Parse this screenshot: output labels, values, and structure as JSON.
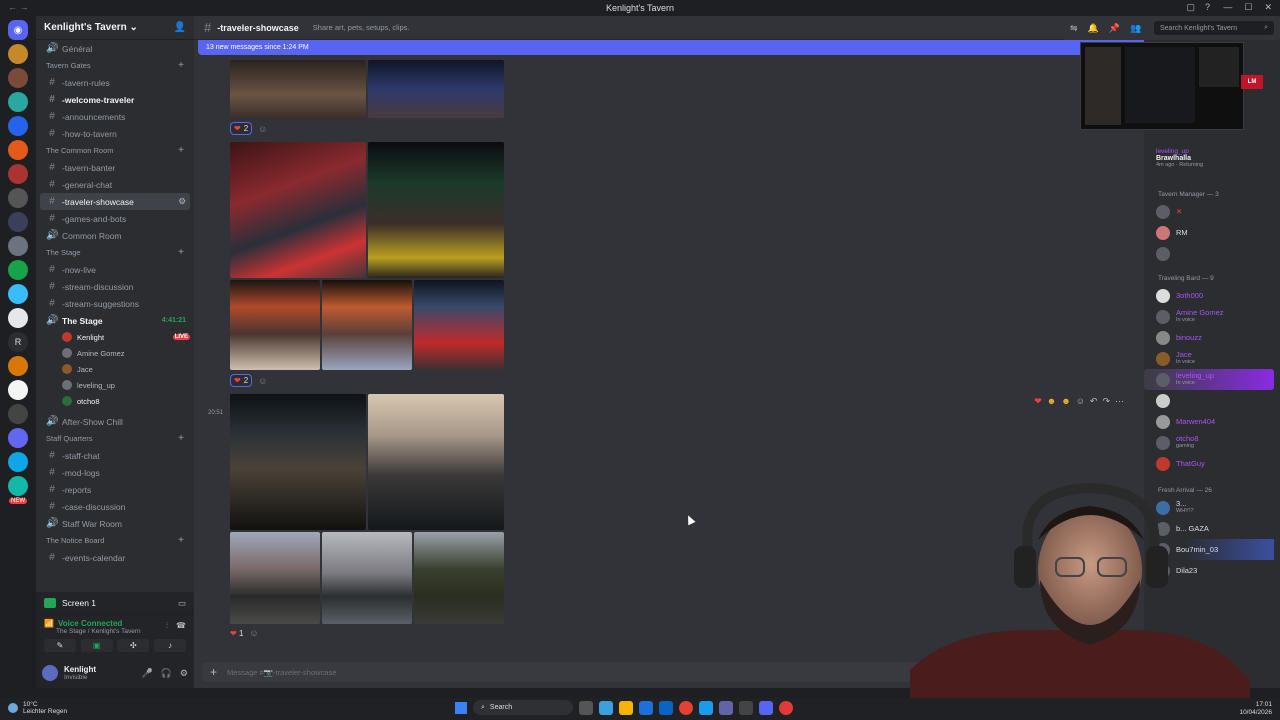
{
  "window": {
    "title": "Kenlight's Tavern",
    "controls": [
      "—",
      "☐",
      "✕"
    ]
  },
  "server": {
    "name": "Kenlight's Tavern",
    "dropdown": "⌄"
  },
  "sidebar": {
    "top_channel": "Général",
    "categories": [
      {
        "name": "Tavern Gates",
        "channels": [
          "-tavern-rules",
          "-welcome-traveler",
          "-announcements",
          "-how-to-tavern"
        ]
      },
      {
        "name": "The Common Room",
        "channels": [
          "-tavern-banter",
          "-general-chat",
          "-traveler-showcase",
          "-games-and-bots",
          "Common Room"
        ]
      },
      {
        "name": "The Stage",
        "channels": [
          "-now-live",
          "-stream-discussion",
          "-stream-suggestions",
          "The Stage"
        ]
      },
      {
        "name": "Staff Quarters",
        "channels": [
          "-staff-chat",
          "-mod-logs",
          "-reports",
          "-case-discussion",
          "Staff War Room"
        ]
      },
      {
        "name": "The Notice Board",
        "channels": [
          "-events-calendar"
        ]
      }
    ],
    "after_show_chill": "After-Show Chill",
    "stage_timer": "4:41:21",
    "stage_users": [
      {
        "name": "Kenlight",
        "badge": "LIVE"
      },
      {
        "name": "Amine Gomez"
      },
      {
        "name": "Jace"
      },
      {
        "name": "leveling_up"
      },
      {
        "name": "otcho8"
      }
    ]
  },
  "screen": {
    "label": "Screen 1"
  },
  "voice": {
    "status": "Voice Connected",
    "location": "The Stage / Kenlight's Tavern"
  },
  "user": {
    "name": "Kenlight",
    "status": "Invisible"
  },
  "channel": {
    "name": "-traveler-showcase",
    "topic": "Share art, pets, setups, clips.",
    "new_messages": "13 new messages since 1:24 PM",
    "timestamp": "20:51",
    "composer_placeholder": "Message #📷-traveler-showcase"
  },
  "reactions": [
    {
      "emoji": "❤",
      "count": "2"
    },
    {
      "emoji": "❤",
      "count": "2"
    },
    {
      "emoji": "❤",
      "count": "1"
    }
  ],
  "search": {
    "placeholder": "Search Kenlight's Tavern"
  },
  "members": {
    "top_activity": {
      "name": "leveling_up",
      "game": "Brawlhalla",
      "sub": "4m ago · Returning"
    },
    "sections": [
      {
        "title": "Tavern Manager — 3",
        "members": [
          {
            "name": "",
            "sub": ""
          },
          {
            "name": "RM",
            "sub": ""
          },
          {
            "name": "",
            "sub": ""
          }
        ]
      },
      {
        "title": "Traveling Bard — 9",
        "members": [
          {
            "name": "3oth000",
            "sub": ""
          },
          {
            "name": "Amine Gomez",
            "sub": "In voice"
          },
          {
            "name": "binouzz",
            "sub": ""
          },
          {
            "name": "Jace",
            "sub": "In voice"
          },
          {
            "name": "leveling_up",
            "sub": "In voice"
          },
          {
            "name": "",
            "sub": ""
          },
          {
            "name": "Marwen404",
            "sub": ""
          },
          {
            "name": "otcho8",
            "sub": "gaming"
          },
          {
            "name": "ThatGuy",
            "sub": ""
          }
        ]
      },
      {
        "title": "Fresh Arrival — 26",
        "members": [
          {
            "name": "3...",
            "sub": "WHY!?"
          },
          {
            "name": "b... GAZA",
            "sub": ""
          },
          {
            "name": "Bou7min_03",
            "sub": ""
          },
          {
            "name": "Dila23",
            "sub": ""
          }
        ]
      }
    ]
  },
  "taskbar": {
    "weather_temp": "10°C",
    "weather_desc": "Leichter Regen",
    "search_label": "Search",
    "time": "17:01",
    "date": "10/04/2026"
  },
  "preview": {
    "logo_text": "LM"
  }
}
